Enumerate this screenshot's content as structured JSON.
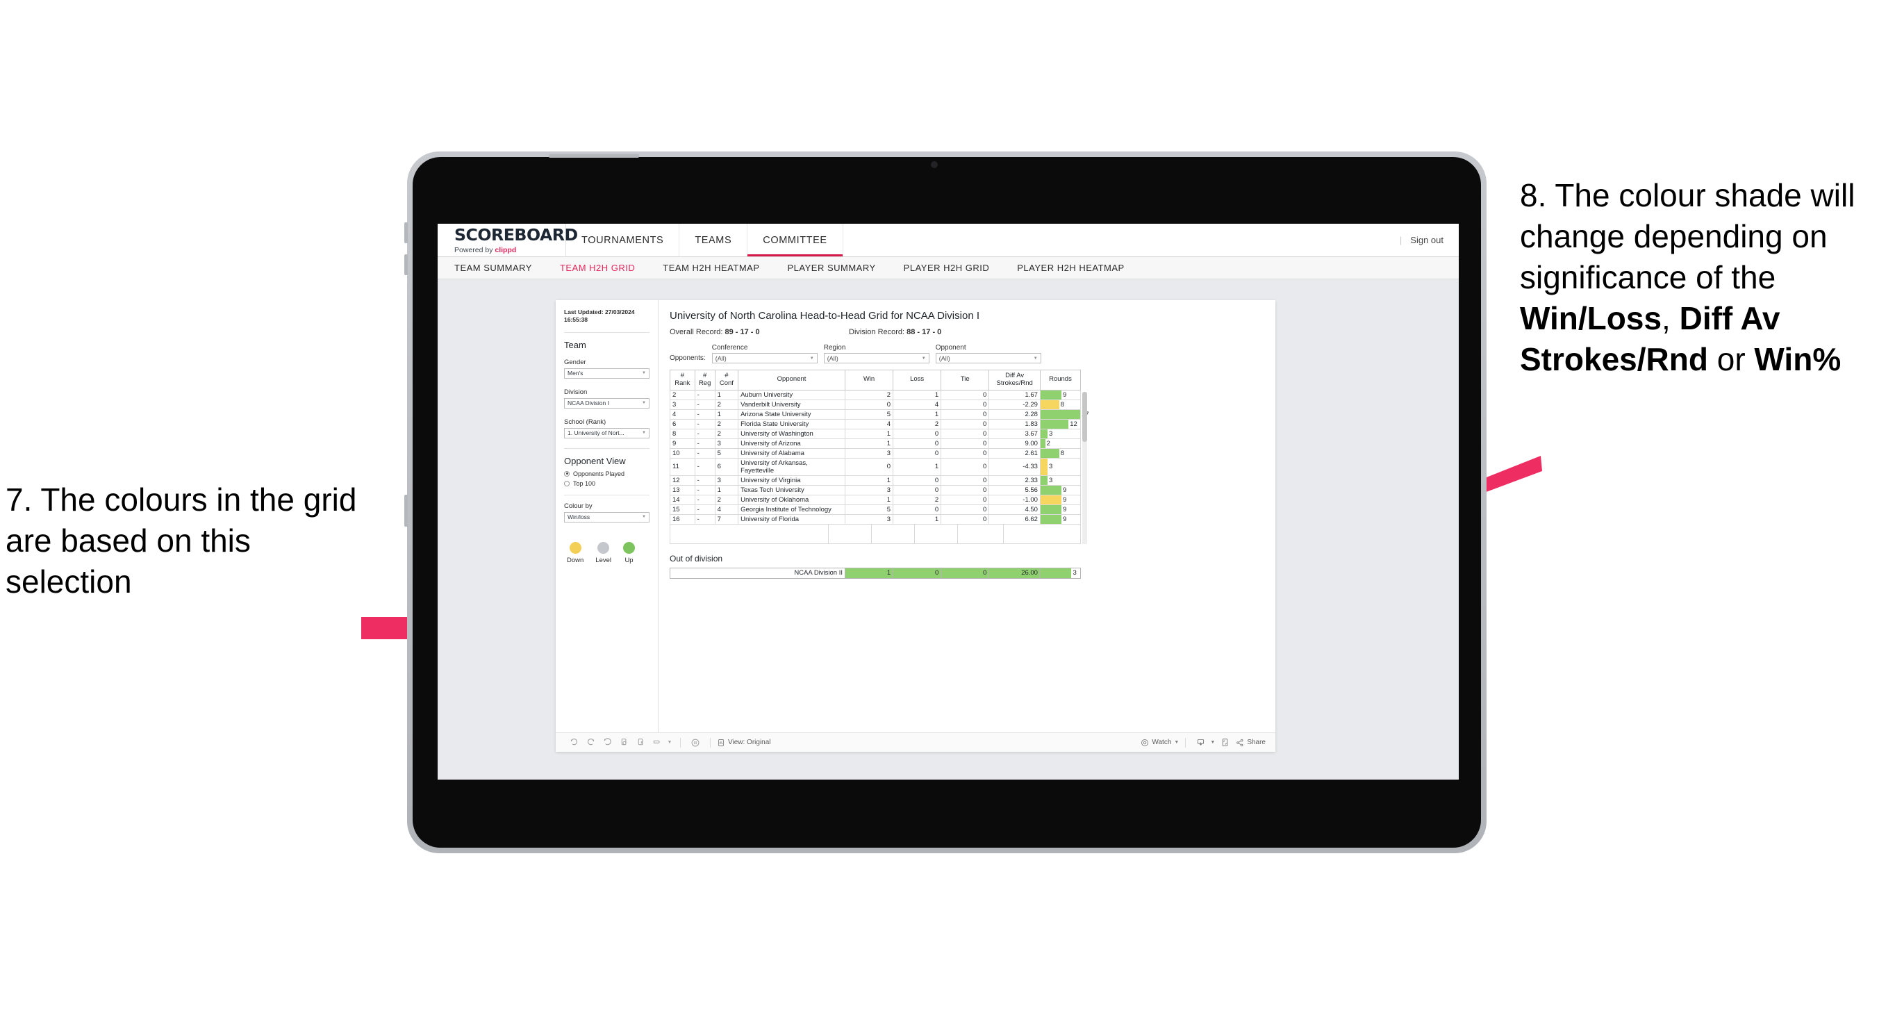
{
  "annotations": {
    "left": "7. The colours in the grid are based on this selection",
    "right_pre": "8. The colour shade will change depending on significance of the ",
    "right_b1": "Win/Loss",
    "right_mid1": ", ",
    "right_b2": "Diff Av Strokes/Rnd",
    "right_mid2": " or ",
    "right_b3": "Win%",
    "accent": "#ee2d62"
  },
  "topnav": {
    "brand_title": "SCOREBOARD",
    "brand_sub_pre": "Powered by ",
    "brand_sub_accent": "clippd",
    "tabs": [
      {
        "label": "TOURNAMENTS",
        "active": false
      },
      {
        "label": "TEAMS",
        "active": false
      },
      {
        "label": "COMMITTEE",
        "active": true
      }
    ],
    "divider": "|",
    "signout": "Sign out"
  },
  "subnav": {
    "tabs": [
      {
        "label": "TEAM SUMMARY",
        "active": false
      },
      {
        "label": "TEAM H2H GRID",
        "active": true
      },
      {
        "label": "TEAM H2H HEATMAP",
        "active": false
      },
      {
        "label": "PLAYER SUMMARY",
        "active": false
      },
      {
        "label": "PLAYER H2H GRID",
        "active": false
      },
      {
        "label": "PLAYER H2H HEATMAP",
        "active": false
      }
    ]
  },
  "left_panel": {
    "last_updated": "Last Updated: 27/03/2024 16:55:38",
    "team_heading": "Team",
    "gender_label": "Gender",
    "gender_value": "Men's",
    "division_label": "Division",
    "division_value": "NCAA Division I",
    "school_label": "School (Rank)",
    "school_value": "1. University of Nort...",
    "opponent_view_heading": "Opponent View",
    "opponent_view_options": [
      {
        "label": "Opponents Played",
        "selected": true
      },
      {
        "label": "Top 100",
        "selected": false
      }
    ],
    "colour_by_label": "Colour by",
    "colour_by_value": "Win/loss",
    "legend": [
      {
        "label": "Down",
        "color": "#f3d055"
      },
      {
        "label": "Level",
        "color": "#c4c7cc"
      },
      {
        "label": "Up",
        "color": "#7ec45e"
      }
    ]
  },
  "viz": {
    "title": "University of North Carolina Head-to-Head Grid for NCAA Division I",
    "overall_record_label": "Overall Record: ",
    "overall_record_value": "89 - 17 - 0",
    "division_record_label": "Division Record: ",
    "division_record_value": "88 - 17 - 0",
    "opponents_label": "Opponents:",
    "filters": [
      {
        "label": "Conference",
        "value": "(All)"
      },
      {
        "label": "Region",
        "value": "(All)"
      },
      {
        "label": "Opponent",
        "value": "(All)"
      }
    ],
    "out_of_division_title": "Out of division"
  },
  "chart_data": {
    "type": "table",
    "title": "University of North Carolina Head-to-Head Grid for NCAA Division I",
    "columns": [
      "# Rank",
      "# Reg",
      "# Conf",
      "Opponent",
      "Win",
      "Loss",
      "Tie",
      "Diff Av Strokes/Rnd",
      "Rounds"
    ],
    "header_lines": {
      "rank": [
        "#",
        "Rank"
      ],
      "reg": [
        "#",
        "Reg"
      ],
      "conf": [
        "#",
        "Conf"
      ],
      "opponent": [
        "Opponent"
      ],
      "win": [
        "Win"
      ],
      "loss": [
        "Loss"
      ],
      "tie": [
        "Tie"
      ],
      "diff": [
        "Diff Av",
        "Strokes/Rnd"
      ],
      "rounds": [
        "Rounds"
      ]
    },
    "rounds_max": 17,
    "colors": {
      "win": "#8fd06f",
      "loss": "#f6d65e"
    },
    "rows": [
      {
        "rank": "2",
        "reg": "-",
        "conf": "1",
        "opponent": "Auburn University",
        "win": "2",
        "loss": "1",
        "tie": "0",
        "diff": "1.67",
        "rounds": "9",
        "state": "win"
      },
      {
        "rank": "3",
        "reg": "-",
        "conf": "2",
        "opponent": "Vanderbilt University",
        "win": "0",
        "loss": "4",
        "tie": "0",
        "diff": "-2.29",
        "rounds": "8",
        "state": "loss"
      },
      {
        "rank": "4",
        "reg": "-",
        "conf": "1",
        "opponent": "Arizona State University",
        "win": "5",
        "loss": "1",
        "tie": "0",
        "diff": "2.28",
        "rounds": "17",
        "state": "win"
      },
      {
        "rank": "6",
        "reg": "-",
        "conf": "2",
        "opponent": "Florida State University",
        "win": "4",
        "loss": "2",
        "tie": "0",
        "diff": "1.83",
        "rounds": "12",
        "state": "win"
      },
      {
        "rank": "8",
        "reg": "-",
        "conf": "2",
        "opponent": "University of Washington",
        "win": "1",
        "loss": "0",
        "tie": "0",
        "diff": "3.67",
        "rounds": "3",
        "state": "win"
      },
      {
        "rank": "9",
        "reg": "-",
        "conf": "3",
        "opponent": "University of Arizona",
        "win": "1",
        "loss": "0",
        "tie": "0",
        "diff": "9.00",
        "rounds": "2",
        "state": "win"
      },
      {
        "rank": "10",
        "reg": "-",
        "conf": "5",
        "opponent": "University of Alabama",
        "win": "3",
        "loss": "0",
        "tie": "0",
        "diff": "2.61",
        "rounds": "8",
        "state": "win"
      },
      {
        "rank": "11",
        "reg": "-",
        "conf": "6",
        "opponent": "University of Arkansas, Fayetteville",
        "win": "0",
        "loss": "1",
        "tie": "0",
        "diff": "-4.33",
        "rounds": "3",
        "state": "loss"
      },
      {
        "rank": "12",
        "reg": "-",
        "conf": "3",
        "opponent": "University of Virginia",
        "win": "1",
        "loss": "0",
        "tie": "0",
        "diff": "2.33",
        "rounds": "3",
        "state": "win"
      },
      {
        "rank": "13",
        "reg": "-",
        "conf": "1",
        "opponent": "Texas Tech University",
        "win": "3",
        "loss": "0",
        "tie": "0",
        "diff": "5.56",
        "rounds": "9",
        "state": "win"
      },
      {
        "rank": "14",
        "reg": "-",
        "conf": "2",
        "opponent": "University of Oklahoma",
        "win": "1",
        "loss": "2",
        "tie": "0",
        "diff": "-1.00",
        "rounds": "9",
        "state": "loss"
      },
      {
        "rank": "15",
        "reg": "-",
        "conf": "4",
        "opponent": "Georgia Institute of Technology",
        "win": "5",
        "loss": "0",
        "tie": "0",
        "diff": "4.50",
        "rounds": "9",
        "state": "win"
      },
      {
        "rank": "16",
        "reg": "-",
        "conf": "7",
        "opponent": "University of Florida",
        "win": "3",
        "loss": "1",
        "tie": "0",
        "diff": "6.62",
        "rounds": "9",
        "state": "win"
      }
    ],
    "out_of_division": [
      {
        "name": "NCAA Division II",
        "win": "1",
        "loss": "0",
        "tie": "0",
        "diff": "26.00",
        "rounds": "3",
        "state": "win"
      }
    ]
  },
  "toolbar": {
    "view_label": "View: Original",
    "watch_label": "Watch",
    "share_label": "Share"
  }
}
